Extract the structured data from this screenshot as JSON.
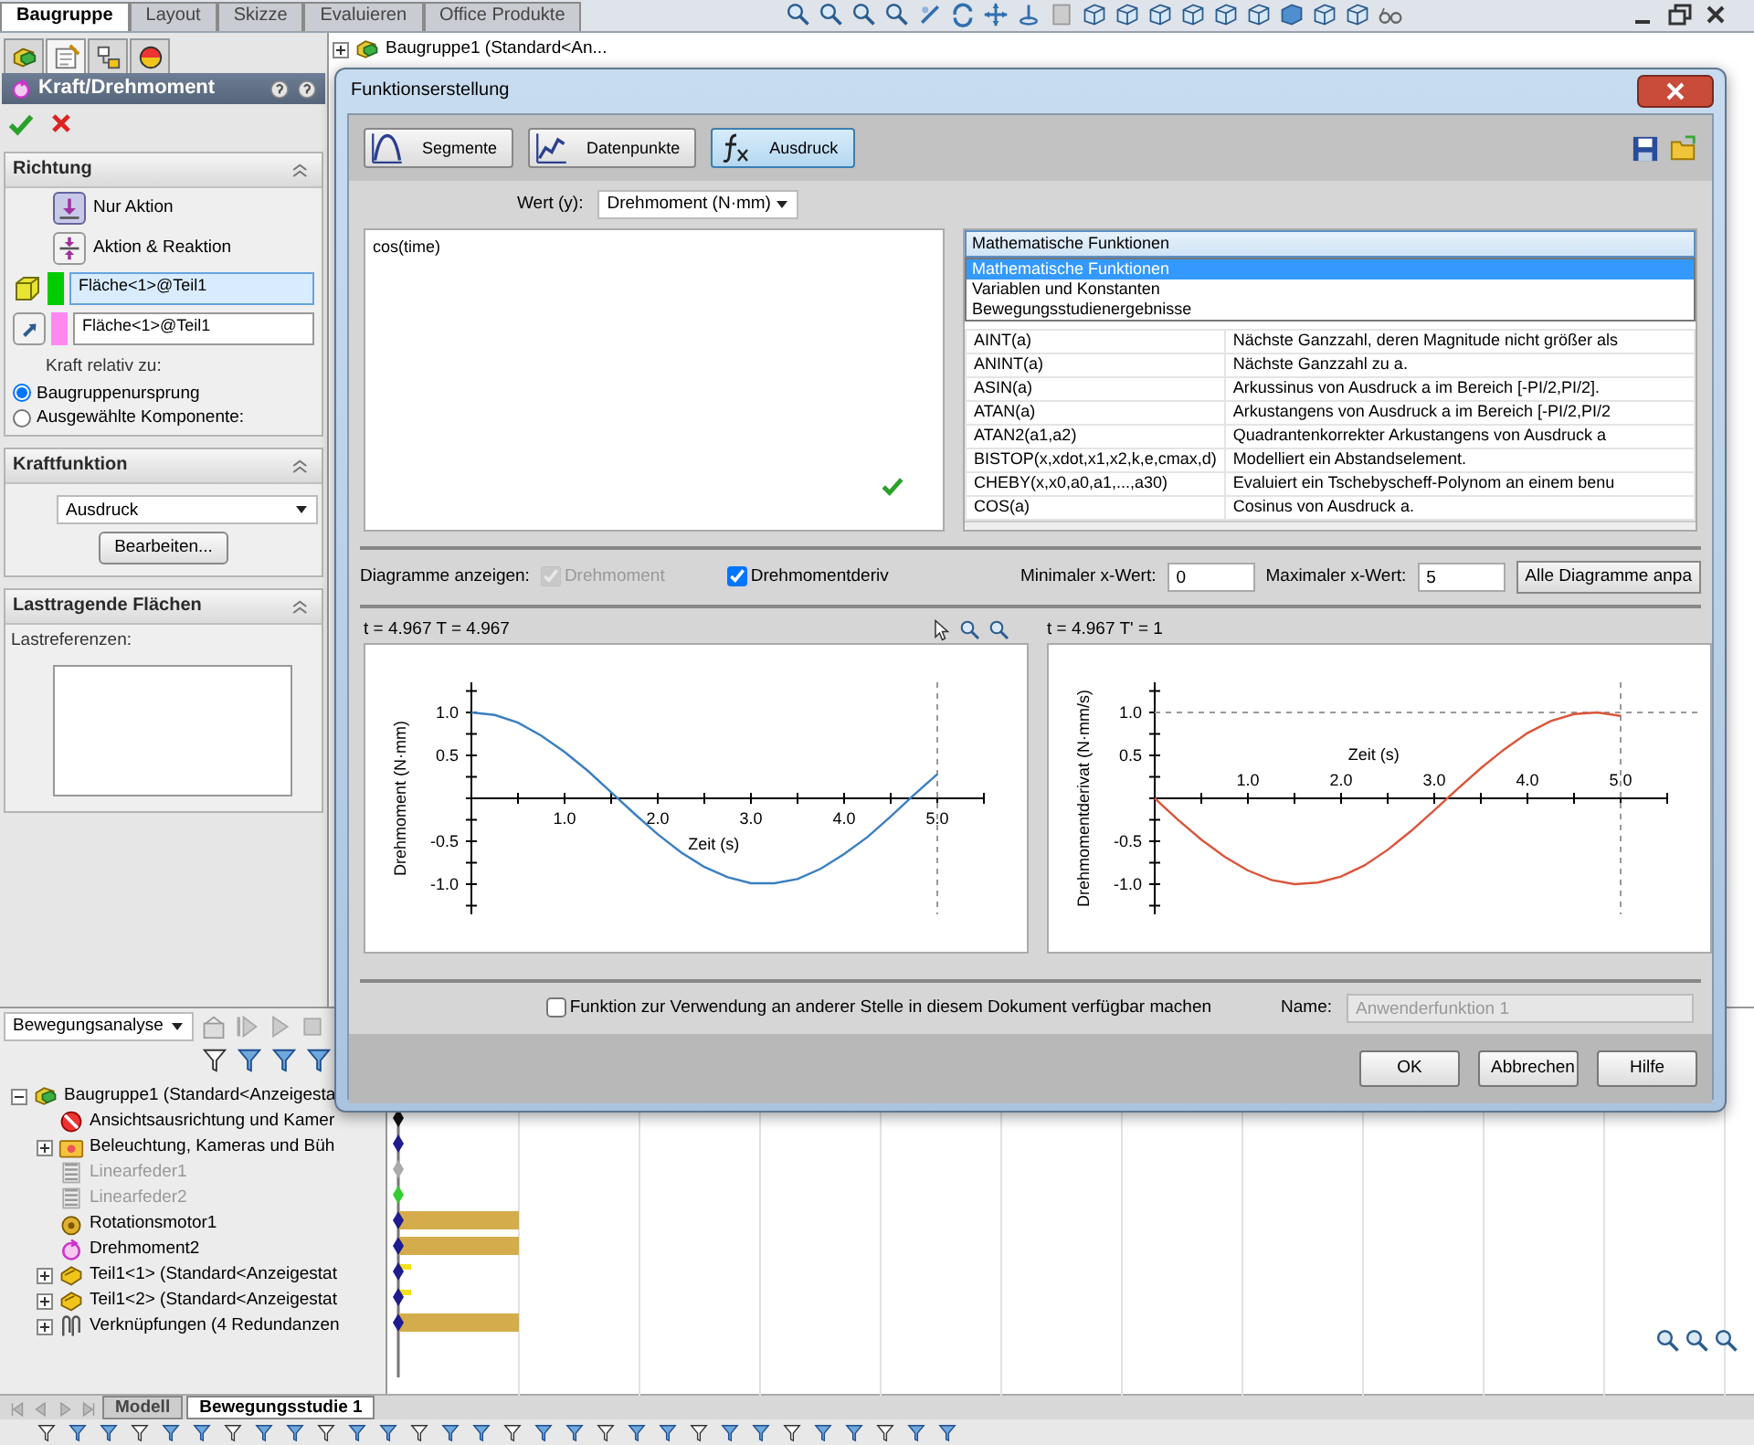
{
  "ribbon_tabs": [
    {
      "label": "Baugruppe",
      "selected": true
    },
    {
      "label": "Layout",
      "selected": false
    },
    {
      "label": "Skizze",
      "selected": false
    },
    {
      "label": "Evaluieren",
      "selected": false
    },
    {
      "label": "Office Produkte",
      "selected": false
    }
  ],
  "graphics": {
    "tree_title": "Baugruppe1 (Standard<An..."
  },
  "property_manager": {
    "panel_tabs": [
      {
        "kind": "feature-tree",
        "selected": false
      },
      {
        "kind": "properties",
        "selected": true
      },
      {
        "kind": "configurations",
        "selected": false
      },
      {
        "kind": "appearance",
        "selected": false
      }
    ],
    "title": "Kraft/Drehmoment",
    "direction": {
      "title": "Richtung",
      "options": [
        {
          "label": "Nur Aktion",
          "selected": true
        },
        {
          "label": "Aktion & Reaktion",
          "selected": false
        }
      ],
      "selections": [
        {
          "value": "Fläche<1>@Teil1",
          "color": "#00cc00",
          "selected": true
        },
        {
          "value": "Fläche<1>@Teil1",
          "color": "#ff88f0",
          "selected": false
        }
      ],
      "relative_label": "Kraft relativ zu:",
      "relative_options": [
        {
          "label": "Baugruppenursprung",
          "selected": true
        },
        {
          "label": "Ausgewählte Komponente:",
          "selected": false
        }
      ]
    },
    "force_function": {
      "title": "Kraftfunktion",
      "value": "Ausdruck",
      "button": "Bearbeiten..."
    },
    "load_faces": {
      "title": "Lasttragende Flächen",
      "label": "Lastreferenzen:"
    }
  },
  "dialog": {
    "title": "Funktionserstellung",
    "modes": [
      {
        "label": "Segmente",
        "kind": "segments",
        "selected": false
      },
      {
        "label": "Datenpunkte",
        "kind": "points",
        "selected": false
      },
      {
        "label": "Ausdruck",
        "kind": "expression",
        "selected": true
      }
    ],
    "value_label": "Wert (y):",
    "value": "Drehmoment (N·mm)",
    "expression": "cos(time)",
    "category": "Mathematische Funktionen",
    "category_options": [
      {
        "label": "Mathematische Funktionen",
        "selected": true
      },
      {
        "label": "Variablen und Konstanten",
        "selected": false
      },
      {
        "label": "Bewegungsstudienergebnisse",
        "selected": false
      }
    ],
    "functions": [
      {
        "name": "AINT(a)",
        "description": "Nächste Ganzzahl, deren Magnitude nicht größer als"
      },
      {
        "name": "ANINT(a)",
        "description": "Nächste Ganzzahl zu a."
      },
      {
        "name": "ASIN(a)",
        "description": "Arkussinus von Ausdruck a im Bereich [-PI/2,PI/2]."
      },
      {
        "name": "ATAN(a)",
        "description": "Arkustangens von Ausdruck a im Bereich [-PI/2,PI/2"
      },
      {
        "name": "ATAN2(a1,a2)",
        "description": "Quadrantenkorrekter Arkustangens von Ausdruck a"
      },
      {
        "name": "BISTOP(x,xdot,x1,x2,k,e,cmax,d)",
        "description": "Modelliert ein Abstandselement."
      },
      {
        "name": "CHEBY(x,x0,a0,a1,...,a30)",
        "description": "Evaluiert ein Tschebyscheff-Polynom an einem benu"
      },
      {
        "name": "COS(a)",
        "description": "Cosinus von Ausdruck a."
      }
    ],
    "show_label": "Diagramme anzeigen:",
    "plots": [
      {
        "label": "Drehmoment",
        "checked": true,
        "disabled": true
      },
      {
        "label": "Drehmomentderiv",
        "checked": true,
        "disabled": false
      }
    ],
    "min_label": "Minimaler x-Wert:",
    "min_value": "0",
    "max_label": "Maximaler x-Wert:",
    "max_value": "5",
    "fit_button": "Alle Diagramme anpa",
    "charts": [
      {
        "readout": "t = 4.967 T = 4.967",
        "chart_data": {
          "type": "line",
          "xlabel": "Zeit (s)",
          "ylabel": "Drehmoment (N·mm)",
          "x": [
            0,
            0.25,
            0.5,
            0.75,
            1,
            1.25,
            1.5,
            1.75,
            2,
            2.25,
            2.5,
            2.75,
            3,
            3.25,
            3.5,
            3.75,
            4,
            4.25,
            4.5,
            4.75,
            5
          ],
          "series": [
            {
              "color": "#3a7fc0",
              "values": [
                1,
                0.97,
                0.88,
                0.73,
                0.54,
                0.32,
                0.07,
                -0.18,
                -0.42,
                -0.63,
                -0.8,
                -0.92,
                -0.99,
                -0.99,
                -0.94,
                -0.82,
                -0.65,
                -0.45,
                -0.21,
                0.04,
                0.28
              ]
            }
          ],
          "xlim": [
            0,
            5.5
          ],
          "ylim": [
            -1.35,
            1.35
          ],
          "xticks": [
            {
              "value": 1,
              "label": "1.0"
            },
            {
              "value": 2,
              "label": "2.0"
            },
            {
              "value": 3,
              "label": "3.0"
            },
            {
              "value": 4,
              "label": "4.0"
            },
            {
              "value": 5,
              "label": "5.0"
            }
          ],
          "yticks": [
            {
              "value": -1,
              "label": "-1.0"
            },
            {
              "value": -0.5,
              "label": "-0.5"
            },
            {
              "value": 0.5,
              "label": "0.5"
            },
            {
              "value": 1,
              "label": "1.0"
            }
          ],
          "ref_lines": [
            {
              "axis": "x",
              "value": 5
            }
          ]
        }
      },
      {
        "readout": "t = 4.967 T' = 1",
        "chart_data": {
          "type": "line",
          "xlabel": "Zeit (s)",
          "ylabel": "Drehmomentderivat (N·mm/s)",
          "x": [
            0,
            0.25,
            0.5,
            0.75,
            1,
            1.25,
            1.5,
            1.75,
            2,
            2.25,
            2.5,
            2.75,
            3,
            3.25,
            3.5,
            3.75,
            4,
            4.25,
            4.5,
            4.75,
            5
          ],
          "series": [
            {
              "color": "#d9553a",
              "values": [
                0,
                -0.25,
                -0.48,
                -0.68,
                -0.84,
                -0.95,
                -1,
                -0.98,
                -0.91,
                -0.78,
                -0.6,
                -0.38,
                -0.14,
                0.11,
                0.35,
                0.57,
                0.76,
                0.9,
                0.98,
                1,
                0.96
              ]
            }
          ],
          "xlim": [
            0,
            5.5
          ],
          "ylim": [
            -1.35,
            1.35
          ],
          "xticks": [
            {
              "value": 1,
              "label": "1.0"
            },
            {
              "value": 2,
              "label": "2.0"
            },
            {
              "value": 3,
              "label": "3.0"
            },
            {
              "value": 4,
              "label": "4.0"
            },
            {
              "value": 5,
              "label": "5.0"
            }
          ],
          "yticks": [
            {
              "value": -1,
              "label": "-1.0"
            },
            {
              "value": -0.5,
              "label": "-0.5"
            },
            {
              "value": 0.5,
              "label": "0.5"
            },
            {
              "value": 1,
              "label": "1.0"
            }
          ],
          "ref_lines": [
            {
              "axis": "x",
              "value": 5
            },
            {
              "axis": "y",
              "value": 1
            }
          ]
        }
      }
    ],
    "share": {
      "label": "Funktion zur Verwendung an anderer Stelle in diesem Dokument verfügbar machen",
      "checked": false
    },
    "name_label": "Name:",
    "name_value": "Anwenderfunktion 1",
    "buttons": [
      "OK",
      "Abbrechen",
      "Hilfe"
    ]
  },
  "motion_manager": {
    "study_type": "Bewegungsanalyse",
    "tree": [
      {
        "label": "Baugruppe1 (Standard<Anzeigesta",
        "kind": "assembly",
        "collapsed": false,
        "disabled": false,
        "children": [
          {
            "label": "Ansichtsausrichtung und Kamer",
            "kind": "view",
            "collapsed": false,
            "disabled": false
          },
          {
            "label": "Beleuchtung, Kameras und Büh",
            "kind": "lights",
            "collapsed": true,
            "disabled": false
          },
          {
            "label": "Linearfeder1",
            "kind": "spring",
            "collapsed": false,
            "disabled": true
          },
          {
            "label": "Linearfeder2",
            "kind": "spring",
            "collapsed": false,
            "disabled": true
          },
          {
            "label": "Rotationsmotor1",
            "kind": "motor",
            "collapsed": false,
            "disabled": false
          },
          {
            "label": "Drehmoment2",
            "kind": "force",
            "collapsed": false,
            "disabled": false
          },
          {
            "label": "Teil1<1> (Standard<Anzeigestat",
            "kind": "part",
            "collapsed": true,
            "disabled": false
          },
          {
            "label": "Teil1<2> (Standard<Anzeigestat",
            "kind": "part",
            "collapsed": true,
            "disabled": false
          },
          {
            "label": "Verknüpfungen (4 Redundanzen",
            "kind": "mates",
            "collapsed": true,
            "disabled": false
          }
        ]
      }
    ]
  },
  "study_tabs": [
    {
      "label": "Modell",
      "selected": false
    },
    {
      "label": "Bewegungsstudie 1",
      "selected": true
    }
  ]
}
